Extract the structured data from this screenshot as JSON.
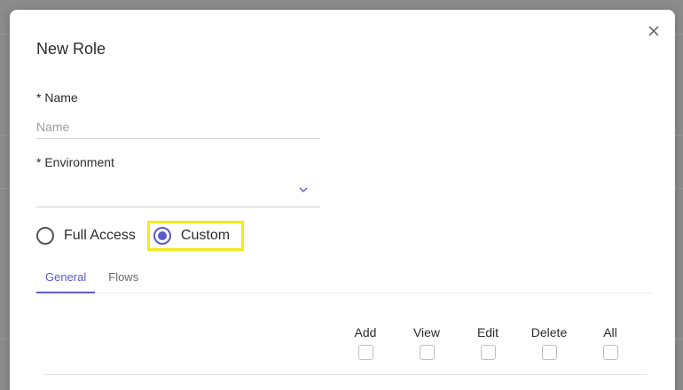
{
  "dialog": {
    "title": "New Role",
    "close_icon": "close-icon"
  },
  "form": {
    "name_label": "* Name",
    "name_placeholder": "Name",
    "name_value": "",
    "environment_label": "* Environment",
    "environment_value": "",
    "access": {
      "options": [
        "Full Access",
        "Custom"
      ],
      "selected": "Custom"
    }
  },
  "tabs": [
    {
      "label": "General",
      "active": true
    },
    {
      "label": "Flows",
      "active": false
    }
  ],
  "permissions": {
    "columns": [
      "Add",
      "View",
      "Edit",
      "Delete",
      "All"
    ]
  },
  "colors": {
    "accent": "#5b5bc8",
    "highlight": "#f2ea1c"
  }
}
